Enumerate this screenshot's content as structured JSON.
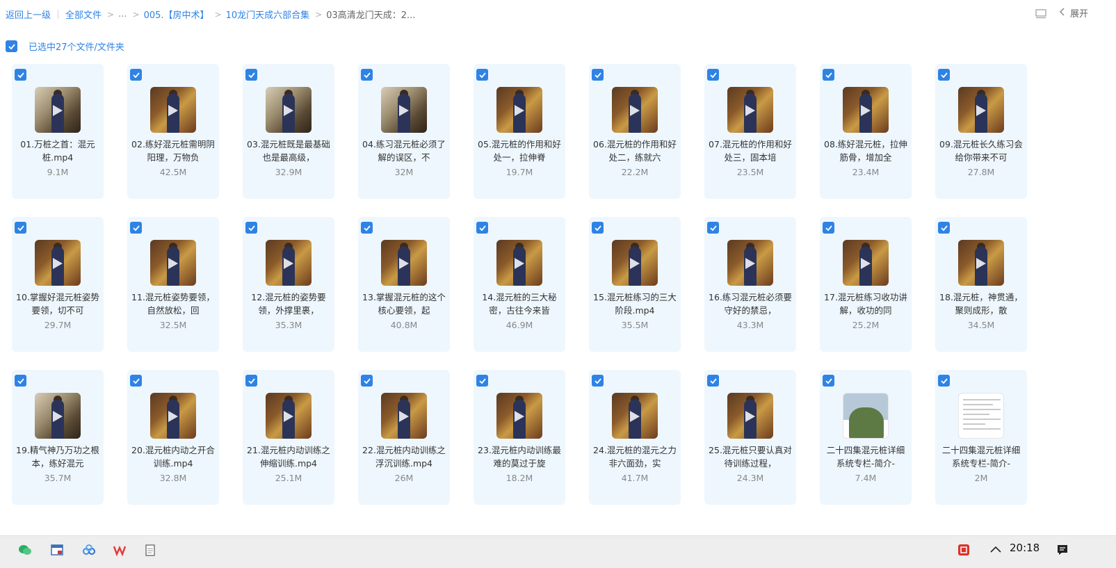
{
  "breadcrumb": {
    "back": "返回上一级",
    "all_files": "全部文件",
    "ellipsis": "...",
    "level1": "005.【房中术】",
    "level2": "10龙门天成六部合集",
    "current": "03高清龙门天成：2..."
  },
  "top_right": {
    "expand_label": "展开",
    "view_icon": "list-view-icon",
    "chevron_icon": "chevron-left-icon"
  },
  "selection": {
    "text": "已选中27个文件/文件夹"
  },
  "files": [
    {
      "name": "01.万桩之首：混元桩.mp4",
      "size": "9.1M",
      "kind": "video-crane"
    },
    {
      "name": "02.练好混元桩需明阴阳理，万物负",
      "size": "42.5M",
      "kind": "video"
    },
    {
      "name": "03.混元桩既是最基础也是最高级，",
      "size": "32.9M",
      "kind": "video-crane"
    },
    {
      "name": "04.练习混元桩必须了解的误区，不",
      "size": "32M",
      "kind": "video-crane"
    },
    {
      "name": "05.混元桩的作用和好处一，拉伸脊",
      "size": "19.7M",
      "kind": "video"
    },
    {
      "name": "06.混元桩的作用和好处二，练就六",
      "size": "22.2M",
      "kind": "video"
    },
    {
      "name": "07.混元桩的作用和好处三，固本培",
      "size": "23.5M",
      "kind": "video"
    },
    {
      "name": "08.练好混元桩，拉伸筋骨，增加全",
      "size": "23.4M",
      "kind": "video"
    },
    {
      "name": "09.混元桩长久练习会给你带来不可",
      "size": "27.8M",
      "kind": "video"
    },
    {
      "name": "10.掌握好混元桩姿势要领，切不可",
      "size": "29.7M",
      "kind": "video"
    },
    {
      "name": "11.混元桩姿势要领，自然放松，回",
      "size": "32.5M",
      "kind": "video"
    },
    {
      "name": "12.混元桩的姿势要领，外撑里裹，",
      "size": "35.3M",
      "kind": "video"
    },
    {
      "name": "13.掌握混元桩的这个核心要领，起",
      "size": "40.8M",
      "kind": "video"
    },
    {
      "name": "14.混元桩的三大秘密，古往今来皆",
      "size": "46.9M",
      "kind": "video"
    },
    {
      "name": "15.混元桩练习的三大阶段.mp4",
      "size": "35.5M",
      "kind": "video"
    },
    {
      "name": "16.练习混元桩必须要守好的禁忌，",
      "size": "43.3M",
      "kind": "video"
    },
    {
      "name": "17.混元桩练习收功讲解，收功的同",
      "size": "25.2M",
      "kind": "video"
    },
    {
      "name": "18.混元桩，神贯通，聚则成形，散",
      "size": "34.5M",
      "kind": "video"
    },
    {
      "name": "19.精气神乃万功之根本，练好混元",
      "size": "35.7M",
      "kind": "video-crane"
    },
    {
      "name": "20.混元桩内动之开合训练.mp4",
      "size": "32.8M",
      "kind": "video"
    },
    {
      "name": "21.混元桩内动训练之伸缩训练.mp4",
      "size": "25.1M",
      "kind": "video"
    },
    {
      "name": "22.混元桩内动训练之浮沉训练.mp4",
      "size": "26M",
      "kind": "video"
    },
    {
      "name": "23.混元桩内动训练最难的莫过于旋",
      "size": "18.2M",
      "kind": "video"
    },
    {
      "name": "24.混元桩的混元之力非六面劲，实",
      "size": "41.7M",
      "kind": "video"
    },
    {
      "name": "25.混元桩只要认真对待训练过程，",
      "size": "24.3M",
      "kind": "video"
    },
    {
      "name": "二十四集混元桩详细系统专栏-简介-",
      "size": "7.4M",
      "kind": "image-photo"
    },
    {
      "name": "二十四集混元桩详细系统专栏-简介-",
      "size": "2M",
      "kind": "image-doc"
    }
  ],
  "taskbar": {
    "apps": [
      "wechat-icon",
      "browser-window-icon",
      "baidu-netdisk-icon",
      "wps-icon",
      "notepad-icon"
    ],
    "clock": "20:18",
    "tray_icons": [
      "input-method-icon",
      "chevron-up-icon",
      "notification-icon"
    ]
  },
  "colors": {
    "accent": "#2f83e4",
    "card_bg": "#eef7fe",
    "taskbar_bg": "#eeeeee"
  }
}
